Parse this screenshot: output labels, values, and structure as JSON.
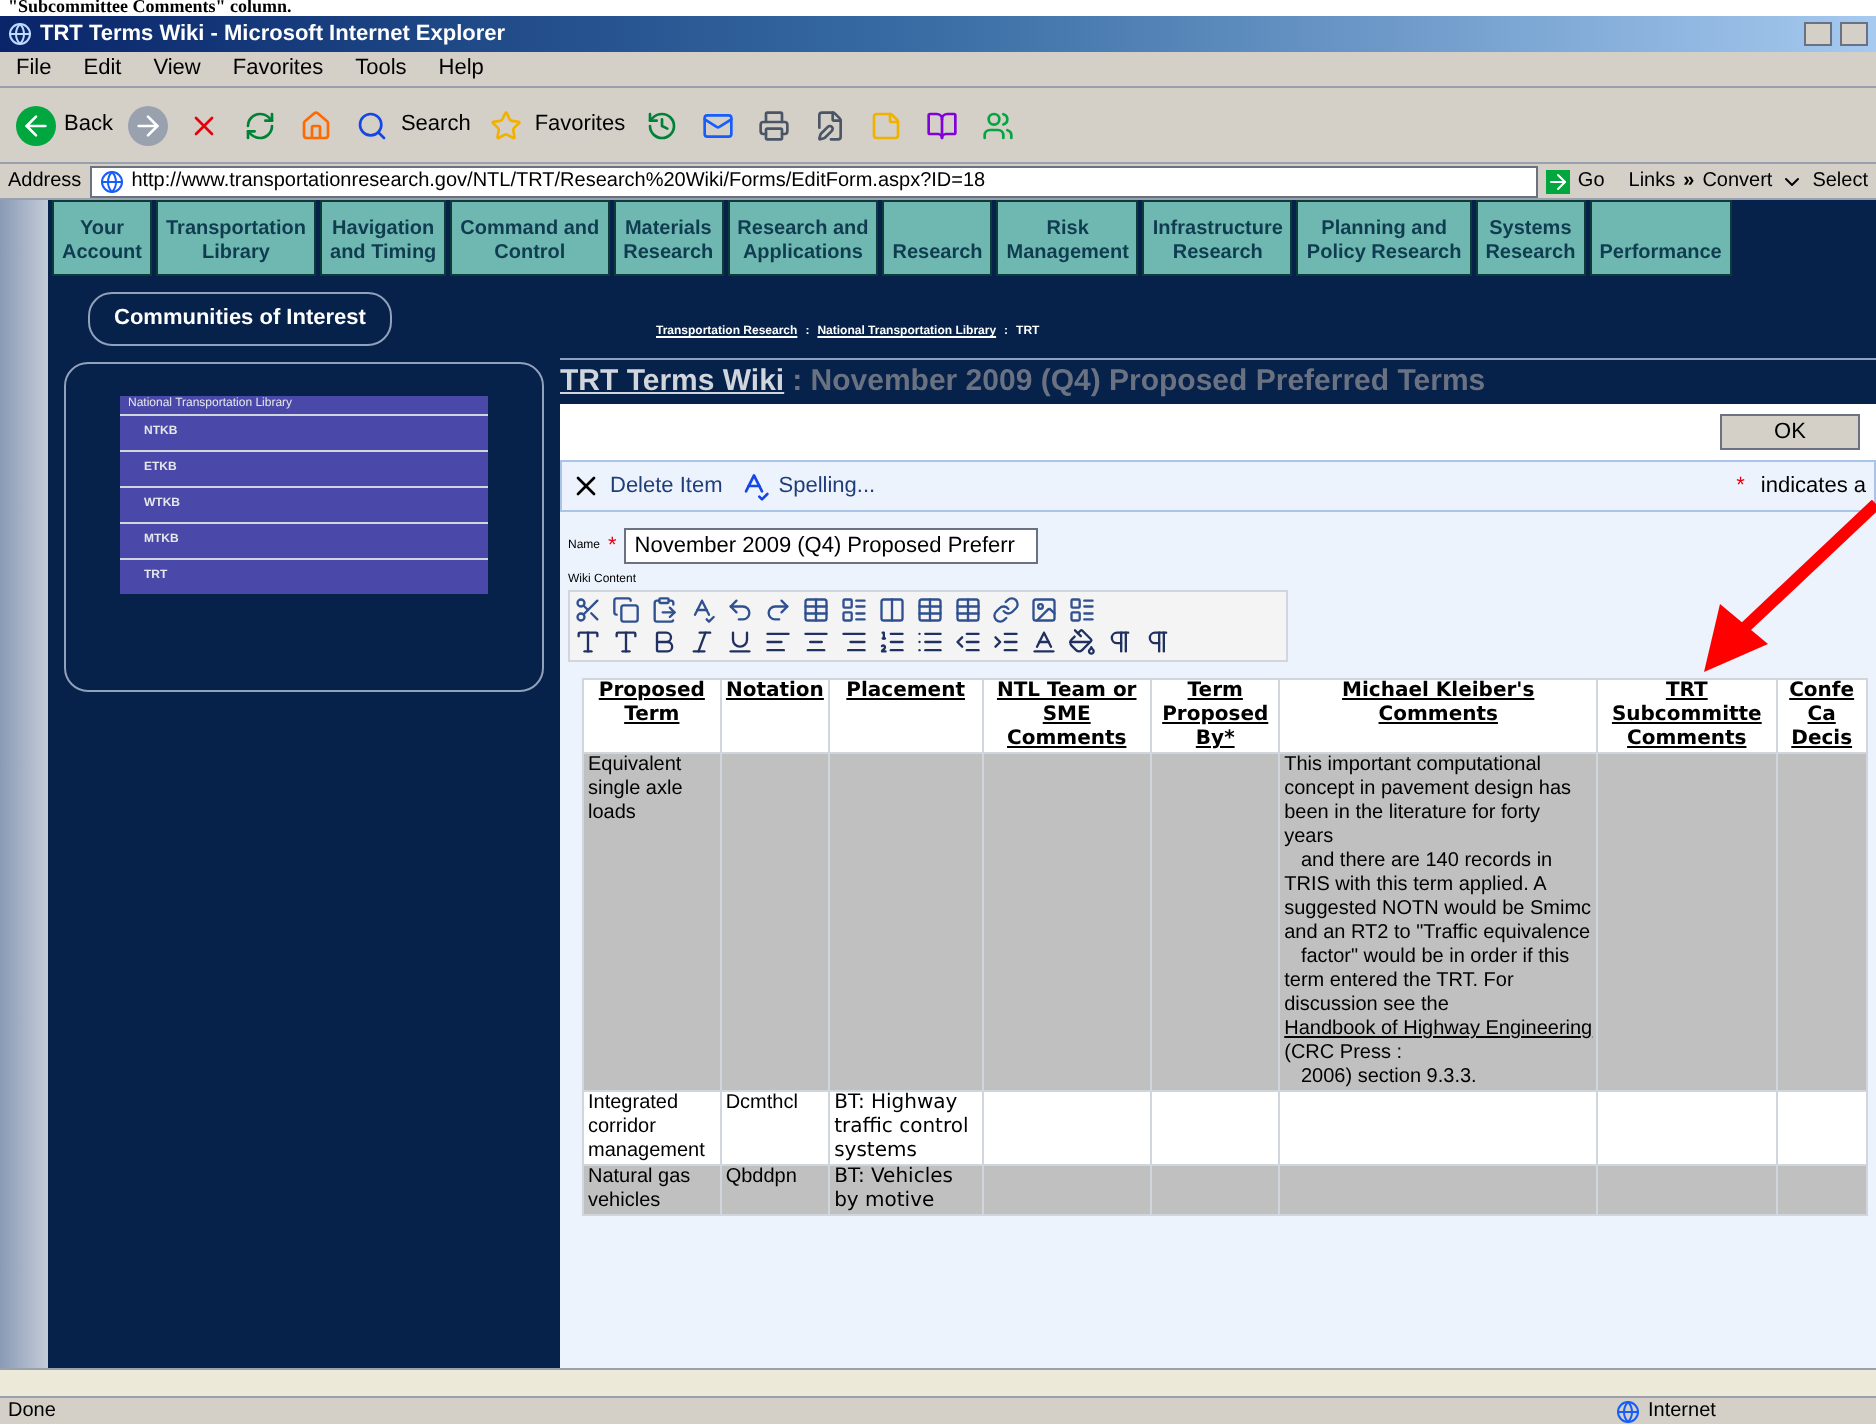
{
  "top_strip": "\"Subcommittee Comments\" column.",
  "window": {
    "title": "TRT Terms Wiki - Microsoft Internet Explorer"
  },
  "menu": [
    "File",
    "Edit",
    "View",
    "Favorites",
    "Tools",
    "Help"
  ],
  "toolbar": [
    {
      "kind": "back",
      "label": "Back"
    },
    {
      "kind": "forward"
    },
    {
      "kind": "stop"
    },
    {
      "kind": "refresh"
    },
    {
      "kind": "home"
    },
    {
      "kind": "search",
      "label": "Search"
    },
    {
      "kind": "favorites",
      "label": "Favorites"
    },
    {
      "kind": "history"
    },
    {
      "kind": "mail"
    },
    {
      "kind": "print"
    },
    {
      "kind": "edit"
    },
    {
      "kind": "note"
    },
    {
      "kind": "research"
    },
    {
      "kind": "messenger"
    }
  ],
  "address": {
    "label": "Address",
    "value": "http://www.transportationresearch.gov/NTL/TRT/Research%20Wiki/Forms/EditForm.aspx?ID=18",
    "go": "Go",
    "links": "Links",
    "links_more": "»",
    "convert": "Convert",
    "select": "Select"
  },
  "nav_tabs": [
    [
      "Your",
      "Account"
    ],
    [
      "Transportation",
      "Library"
    ],
    [
      "Havigation",
      "and Timing"
    ],
    [
      "Command and",
      "Control"
    ],
    [
      "Materials",
      "Research"
    ],
    [
      "Research and",
      "Applications"
    ],
    [
      "Research"
    ],
    [
      "Risk",
      "Management"
    ],
    [
      "Infrastructure",
      "Research"
    ],
    [
      "Planning and",
      "Policy Research"
    ],
    [
      "Systems",
      "Research"
    ],
    [
      "Performance"
    ]
  ],
  "sidebar": {
    "heading": "Communities of Interest",
    "panel_title": "National Transportation Library",
    "items": [
      "NTKB",
      "ETKB",
      "WTKB",
      "MTKB",
      "TRT"
    ]
  },
  "breadcrumb": [
    {
      "label": "Transportation Research",
      "link": true
    },
    {
      "label": "National Transportation Library",
      "link": true
    },
    {
      "label": "TRT",
      "link": false
    }
  ],
  "breadcrumb_sep": ":",
  "page_title": {
    "link": "TRT Terms Wiki",
    "rest": ": November 2009 (Q4) Proposed Preferred Terms"
  },
  "ok_button": "OK",
  "actions": [
    {
      "kind": "delete",
      "label": "Delete Item"
    },
    {
      "kind": "spelling",
      "label": "Spelling..."
    }
  ],
  "required_note": {
    "star": "*",
    "text": "indicates a"
  },
  "name_field": {
    "label": "Name",
    "star": "*",
    "value": "November 2009 (Q4) Proposed Preferr"
  },
  "wiki_label": "Wiki Content",
  "table": {
    "columns": [
      "Proposed\nTerm",
      "Notation",
      "Placement",
      "NTL Team or\nSME\nComments",
      "Term\nProposed\nBy*",
      "Michael Kleiber's\nComments",
      "TRT\nSubcommitte\nComments",
      "Confe\nCa\nDecis"
    ],
    "rows": [
      {
        "cells": [
          "Equivalent single axle loads",
          "",
          "",
          "",
          "",
          {
            "text": "This important computational concept in pavement design has been in the literature for forty years\n   and there are 140 records in TRIS with this term applied. A suggested NOTN would be Smimc and an RT2 to \"Traffic equivalence\n   factor\" would be in order if this term entered the TRT. For discussion see the ",
            "link": "Handbook of Highway Engineering",
            "after": " (CRC Press :\n   2006) section 9.3.3."
          },
          "",
          ""
        ]
      },
      {
        "cells": [
          "Integrated corridor management",
          "Dcmthcl",
          "BT: Highway traffic control systems",
          "",
          "",
          "",
          "",
          ""
        ]
      },
      {
        "cells": [
          "Natural gas vehicles",
          "Qbddpn",
          "BT: Vehicles by motive",
          "",
          "",
          "",
          "",
          ""
        ]
      }
    ]
  },
  "status_bar": {
    "text": "Done",
    "zone": "Internet"
  }
}
